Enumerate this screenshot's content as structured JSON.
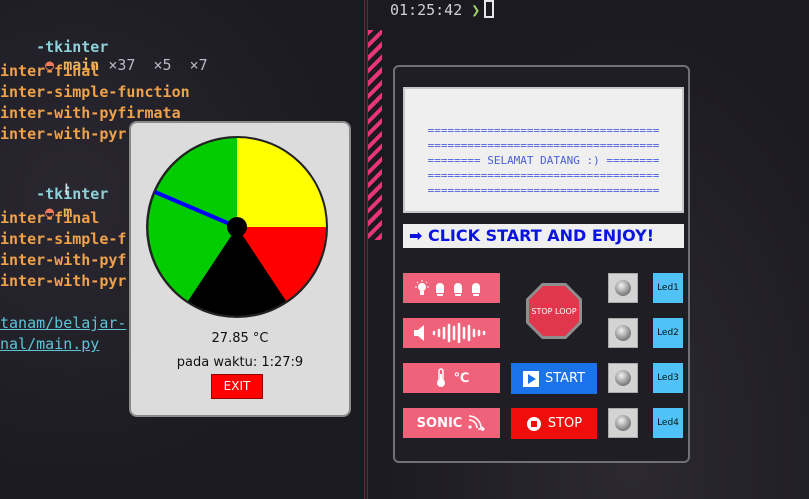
{
  "terminal_left": {
    "prompt1": {
      "dir": "-tkinter",
      "branch": "main",
      "stats": " ×37  ×5  ×7"
    },
    "list1": [
      "inter-final",
      "inter-simple-function",
      "inter-with-pyfirmata",
      "inter-with-pyr"
    ],
    "prompt2": {
      "dir": "-tkinter",
      "branch": "m"
    },
    "list2": [
      "inter-final",
      "inter-simple-f",
      "inter-with-pyf",
      "inter-with-pyr"
    ],
    "path1": "tanam/belajar-",
    "path2": "nal/main.py"
  },
  "terminal_right": {
    "time": "01:25:42",
    "arrow": "❯"
  },
  "gauge_window": {
    "temperature": "27.85 °C",
    "time_text": "pada waktu: 1:27:9",
    "exit_label": "EXIT",
    "gauge_colors": [
      "#00cc00",
      "#ffff00",
      "#ff0000",
      "#000000",
      "#00cc00"
    ],
    "needle_color": "#0000ff"
  },
  "control_panel": {
    "welcome_lines": [
      "===================================",
      "===================================",
      "======== SELAMAT DATANG :) ========",
      "===================================",
      "==================================="
    ],
    "banner": "➡ CLICK START AND ENJOY!",
    "buttons": {
      "led_icon": "lightbulb-led-icon",
      "sound_icon": "sound-wave-icon",
      "temp_label": "℃",
      "sonic_label": "SONIC",
      "stop_loop_label": "STOP LOOP",
      "start_label": "START",
      "stop_label": "STOP"
    },
    "led_labels": [
      "Led1",
      "Led2",
      "Led3",
      "Led4"
    ]
  }
}
